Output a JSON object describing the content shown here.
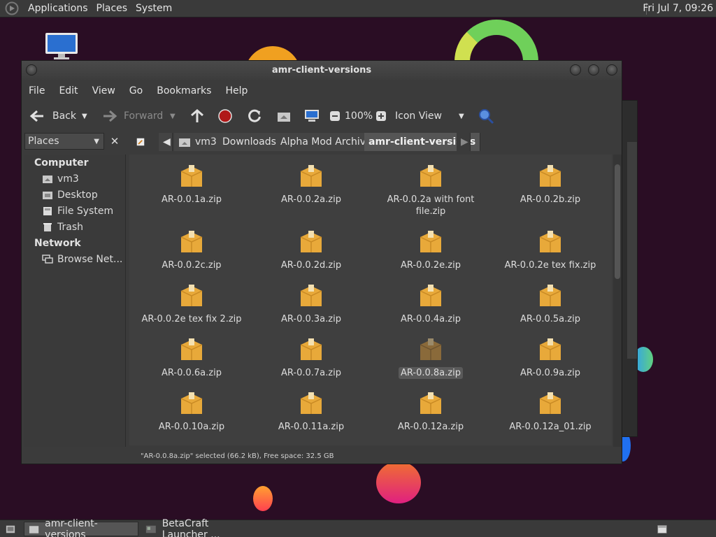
{
  "top_panel": {
    "menus": [
      "Applications",
      "Places",
      "System"
    ],
    "clock": "Fri Jul 7, 09:26"
  },
  "window": {
    "title": "amr-client-versions",
    "menus": [
      "File",
      "Edit",
      "View",
      "Go",
      "Bookmarks",
      "Help"
    ]
  },
  "toolbar": {
    "back_label": "Back",
    "forward_label": "Forward",
    "zoom": "100%",
    "view_mode": "Icon View"
  },
  "sidebar": {
    "selector_label": "Places",
    "sections": [
      {
        "title": "Computer",
        "items": [
          "vm3",
          "Desktop",
          "File System",
          "Trash"
        ]
      },
      {
        "title": "Network",
        "items": [
          "Browse Net..."
        ]
      }
    ]
  },
  "breadcrumb": [
    "vm3",
    "Downloads",
    "Alpha Mod Archive",
    "amr-client-versions"
  ],
  "files": [
    "AR-0.0.1a.zip",
    "AR-0.0.2a.zip",
    "AR-0.0.2a with font file.zip",
    "AR-0.0.2b.zip",
    "AR-0.0.2c.zip",
    "AR-0.0.2d.zip",
    "AR-0.0.2e.zip",
    "AR-0.0.2e tex fix.zip",
    "AR-0.0.2e tex fix 2.zip",
    "AR-0.0.3a.zip",
    "AR-0.0.4a.zip",
    "AR-0.0.5a.zip",
    "AR-0.0.6a.zip",
    "AR-0.0.7a.zip",
    "AR-0.0.8a.zip",
    "AR-0.0.9a.zip",
    "AR-0.0.10a.zip",
    "AR-0.0.11a.zip",
    "AR-0.0.12a.zip",
    "AR-0.0.12a_01.zip"
  ],
  "selected_file": "AR-0.0.8a.zip",
  "status_text": "\"AR-0.0.8a.zip\" selected (66.2 kB), Free space: 32.5 GB",
  "taskbar": {
    "tasks": [
      "amr-client-versions",
      "BetaCraft Launcher ..."
    ]
  },
  "colors": {
    "desktop_bg": "#2a0d24",
    "window_bg": "#3b3b3b",
    "accent_icon": "#e8a93a"
  }
}
